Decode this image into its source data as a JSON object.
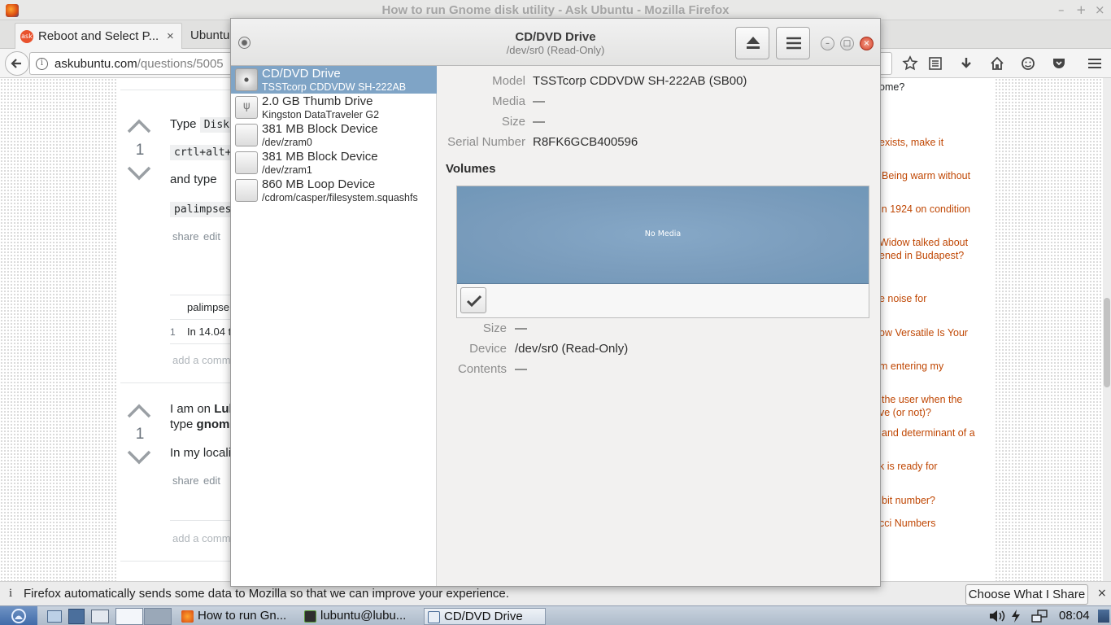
{
  "firefox": {
    "window_title": "How to run Gnome disk utility - Ask Ubuntu - Mozilla Firefox",
    "window_controls": {
      "minimize": "–",
      "maximize": "+",
      "close": "×"
    },
    "tabs": [
      {
        "label": "Reboot and Select P..."
      },
      {
        "label": "Ubuntu"
      }
    ],
    "tab_close": "×",
    "url": {
      "domain": "askubuntu.com",
      "path": "/questions/5005"
    }
  },
  "page": {
    "answer1": {
      "votes": "1",
      "type_label": "Type",
      "code_disk": "Disk",
      "code_keys": "crtl+alt+",
      "and_type": "and type",
      "code_palimpsest": "palimpses",
      "share": "share",
      "edit": "edit",
      "comment_code": "palimpse",
      "comment_num": "1",
      "comment_text": "In 14.04 t",
      "add_comment": "add a comm"
    },
    "answer2": {
      "votes": "1",
      "text1_prefix": "I am on ",
      "text1_bold": "Lub",
      "text2_prefix": "type ",
      "text2_bold": "gnom",
      "text3": "In my locali",
      "share": "share",
      "edit": "edit",
      "add_comment": "add a comm"
    },
    "sidebar_links": [
      "ome?",
      "exists, make it",
      "Being warm without",
      "in 1924 on condition",
      "Widow talked about",
      "ened in Budapest?",
      "e noise for",
      "ow Versatile Is Your",
      "m entering my",
      "the user when the",
      "ve (or not)?",
      "and determinant of a",
      "k is ready for",
      "bit number?",
      "cci Numbers"
    ]
  },
  "notification": {
    "icon": "i",
    "message": "Firefox automatically sends some data to Mozilla so that we can improve your experience.",
    "button": "Choose What I Share",
    "close": "×"
  },
  "taskbar": {
    "tasks": [
      {
        "label": "How to run Gn..."
      },
      {
        "label": "lubuntu@lubu..."
      },
      {
        "label": "CD/DVD Drive"
      }
    ],
    "clock": "08:04"
  },
  "disks": {
    "title": "CD/DVD Drive",
    "subtitle": "/dev/sr0 (Read-Only)",
    "devices": [
      {
        "name": "CD/DVD Drive",
        "sub": "TSSTcorp CDDVDW SH-222AB",
        "icon": "optical-disc-icon"
      },
      {
        "name": "2.0 GB Thumb Drive",
        "sub": "Kingston DataTraveler G2",
        "icon": "usb-drive-icon"
      },
      {
        "name": "381 MB Block Device",
        "sub": "/dev/zram0",
        "icon": "hard-disk-icon"
      },
      {
        "name": "381 MB Block Device",
        "sub": "/dev/zram1",
        "icon": "hard-disk-icon"
      },
      {
        "name": "860 MB Loop Device",
        "sub": "/cdrom/casper/filesystem.squashfs",
        "icon": "hard-disk-icon"
      }
    ],
    "props": {
      "model_label": "Model",
      "model": "TSSTcorp CDDVDW SH-222AB (SB00)",
      "media_label": "Media",
      "media": "—",
      "size_label": "Size",
      "size": "—",
      "serial_label": "Serial Number",
      "serial": "R8FK6GCB400596"
    },
    "volumes_heading": "Volumes",
    "volume_graphic_label": "No Media",
    "volume_props": {
      "size_label": "Size",
      "size": "—",
      "device_label": "Device",
      "device": "/dev/sr0 (Read-Only)",
      "contents_label": "Contents",
      "contents": "—"
    },
    "colors": {
      "selection": "#7fa4c6",
      "volume_fill": "#7a9cbc"
    }
  }
}
